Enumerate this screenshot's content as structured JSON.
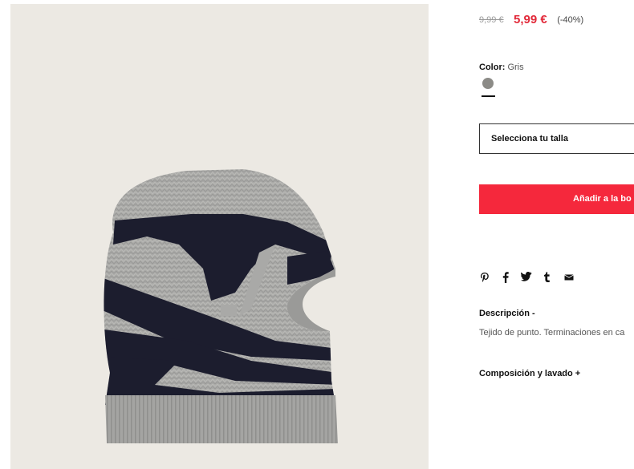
{
  "product": {
    "image_alt": "Pasamontañas de punto gris con dibujo de casco"
  },
  "price": {
    "old": "9,99 €",
    "new": "5,99 €",
    "discount": "(-40%)"
  },
  "color": {
    "label": "Color:",
    "value": "Gris",
    "swatch_color": "#8c8b87"
  },
  "size": {
    "placeholder": "Selecciona tu talla"
  },
  "cart": {
    "add_label": "Añadir a la bo"
  },
  "share": {
    "icons": [
      "pinterest-icon",
      "facebook-icon",
      "twitter-icon",
      "tumblr-icon",
      "mail-icon"
    ]
  },
  "description": {
    "title": "Descripción  -",
    "text": "Tejido de punto. Terminaciones en ca"
  },
  "composition": {
    "title": "Composición y lavado  +"
  },
  "colors": {
    "accent": "#f5283c",
    "sale_price": "#e22a3a",
    "image_bg": "#ece9e3",
    "knit_gray": "#a9a9a7",
    "knit_navy": "#1c1d2e"
  }
}
